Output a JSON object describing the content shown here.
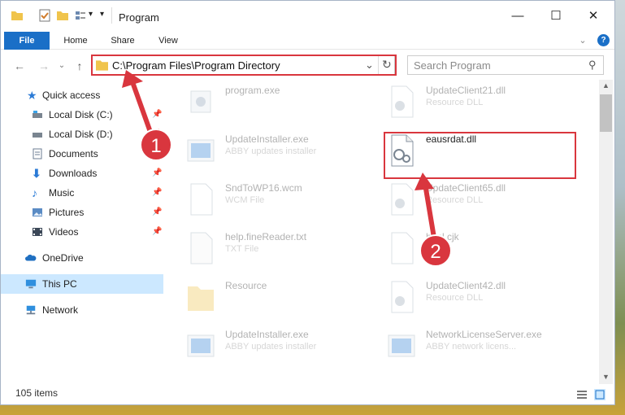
{
  "window": {
    "title": "Program",
    "controls": {
      "minimize": "—",
      "maximize": "☐",
      "close": "✕"
    }
  },
  "ribbon": {
    "tabs": [
      "File",
      "Home",
      "Share",
      "View"
    ],
    "help": "?",
    "expand": "⌄"
  },
  "nav": {
    "back": "←",
    "forward": "→",
    "recent": "⌄",
    "up": "↑",
    "address": "C:\\Program Files\\Program Directory",
    "address_dropdown": "⌄",
    "refresh": "↻",
    "search_placeholder": "Search Program",
    "search_icon": "⚲"
  },
  "sidebar": {
    "items": [
      {
        "label": "Quick access",
        "icon": "star-icon",
        "pinned": false
      },
      {
        "label": "Local Disk (C:)",
        "icon": "drive-icon",
        "pinned": true
      },
      {
        "label": "Local Disk (D:)",
        "icon": "drive-icon",
        "pinned": true
      },
      {
        "label": "Documents",
        "icon": "documents-icon",
        "pinned": true
      },
      {
        "label": "Downloads",
        "icon": "download-icon",
        "pinned": true
      },
      {
        "label": "Music",
        "icon": "music-icon",
        "pinned": true
      },
      {
        "label": "Pictures",
        "icon": "pictures-icon",
        "pinned": true
      },
      {
        "label": "Videos",
        "icon": "videos-icon",
        "pinned": true
      },
      {
        "label": "OneDrive",
        "icon": "cloud-icon",
        "pinned": false
      },
      {
        "label": "This PC",
        "icon": "pc-icon",
        "pinned": false
      },
      {
        "label": "Network",
        "icon": "network-icon",
        "pinned": false
      }
    ]
  },
  "files": [
    {
      "name": "program.exe",
      "sub": ""
    },
    {
      "name": "UpdateClient21.dll",
      "sub": "Resource DLL"
    },
    {
      "name": "UpdateInstaller.exe",
      "sub": "ABBY updates installer"
    },
    {
      "name": "eausrdat.dll",
      "sub": ""
    },
    {
      "name": "SndToWP16.wcm",
      "sub": "WCM File"
    },
    {
      "name": "UpdateClient65.dll",
      "sub": "Resource DLL"
    },
    {
      "name": "help.fineReader.txt",
      "sub": "TXT File"
    },
    {
      "name": "html.cjk",
      "sub": ""
    },
    {
      "name": "Resource",
      "sub": ""
    },
    {
      "name": "UpdateClient42.dll",
      "sub": "Resource DLL"
    },
    {
      "name": "UpdateInstaller.exe",
      "sub": "ABBY updates installer"
    },
    {
      "name": "NetworkLicenseServer.exe",
      "sub": "ABBY network licens..."
    }
  ],
  "status": {
    "count": "105 items"
  },
  "annotations": {
    "step1": "1",
    "step2": "2"
  },
  "colors": {
    "accent": "#1a6fc7",
    "highlight": "#d9363e",
    "selected": "#cce8ff"
  }
}
